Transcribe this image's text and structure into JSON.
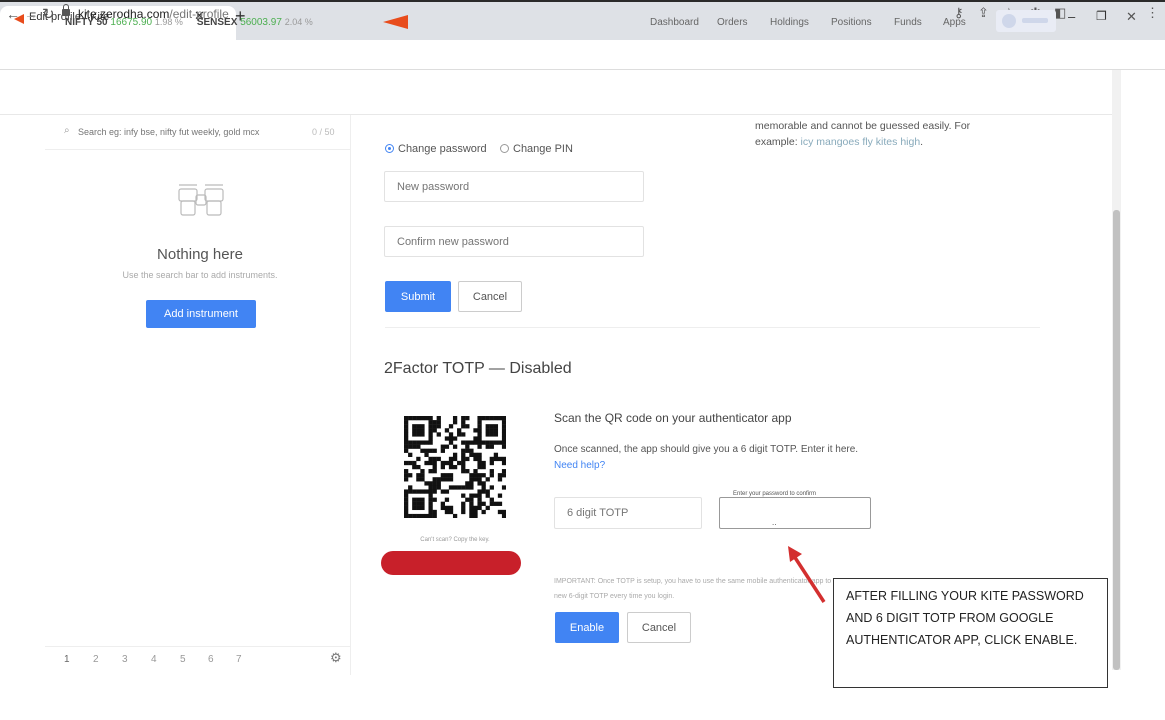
{
  "browser": {
    "tab_title": "Edit profile / Kite",
    "url_host": "kite.zerodha.com",
    "url_path": "/edit-profile"
  },
  "header": {
    "nifty_name": "NIFTY 50",
    "nifty_value": "16675.90",
    "nifty_change": "1.98 %",
    "sensex_name": "SENSEX",
    "sensex_value": "56003.97",
    "sensex_change": "2.04 %",
    "nav": [
      "Dashboard",
      "Orders",
      "Holdings",
      "Positions",
      "Funds",
      "Apps"
    ]
  },
  "sidebar": {
    "search_placeholder": "Search eg: infy bse, nifty fut weekly, gold mcx",
    "search_count": "0 / 50",
    "empty_title": "Nothing here",
    "empty_sub": "Use the search bar to add instruments.",
    "add_button": "Add instrument",
    "pages": [
      "1",
      "2",
      "3",
      "4",
      "5",
      "6",
      "7"
    ]
  },
  "password": {
    "radio_password": "Change password",
    "radio_pin": "Change PIN",
    "hint_line1": "memorable and cannot be guessed easily. For",
    "hint_example_label": "example:",
    "hint_example": "icy mangoes fly kites high",
    "new_placeholder": "New password",
    "confirm_placeholder": "Confirm new password",
    "submit": "Submit",
    "cancel": "Cancel"
  },
  "totp": {
    "title": "2Factor TOTP — Disabled",
    "cant_scan": "Can't scan? Copy the key.",
    "scan_title": "Scan the QR code on your authenticator app",
    "scan_desc": "Once scanned, the app should give you a 6 digit TOTP. Enter it here.",
    "need_help": "Need help?",
    "totp_placeholder": "6 digit TOTP",
    "pw_legend": "Enter your password to confirm",
    "pw_dots": "..",
    "important": "IMPORTANT: Once TOTP is setup, you have to use the same mobile authenticator app to generate a new 6-digit TOTP every time you login.",
    "enable": "Enable",
    "cancel": "Cancel"
  },
  "annotation": {
    "callout": "AFTER FILLING YOUR KITE PASSWORD AND 6 DIGIT TOTP FROM GOOGLE AUTHENTICATOR APP, CLICK ENABLE."
  },
  "colors": {
    "accent": "#4184f3",
    "brand": "#e84c1c",
    "positive": "#4caf50",
    "redaction": "#c8202a",
    "arrow": "#d32f2f"
  }
}
